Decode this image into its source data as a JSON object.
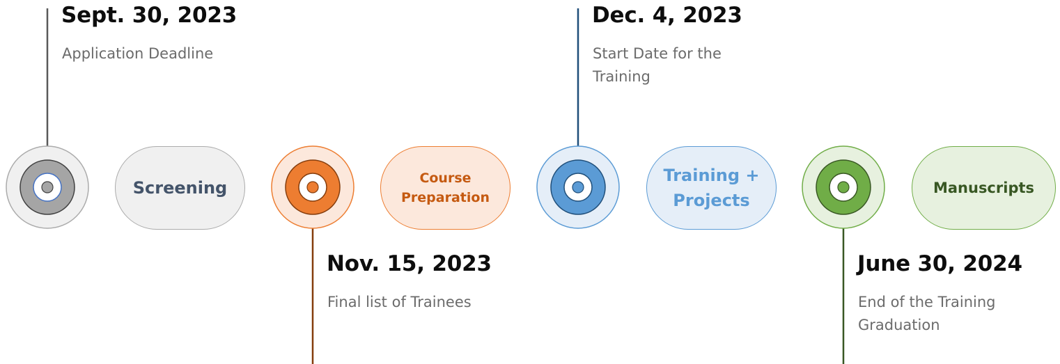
{
  "milestones": [
    {
      "date": "Sept. 30, 2023",
      "description": [
        "Application Deadline"
      ]
    },
    {
      "date": "Nov. 15, 2023",
      "description": [
        "Final list of Trainees"
      ]
    },
    {
      "date": "Dec. 4, 2023",
      "description": [
        "Start Date for the",
        "Training"
      ]
    },
    {
      "date": "June 30, 2024",
      "description": [
        "End of the Training",
        "Graduation"
      ]
    }
  ],
  "phases": [
    {
      "label": [
        "Screening"
      ]
    },
    {
      "label": [
        "Course",
        "Preparation"
      ]
    },
    {
      "label": [
        "Training +",
        "Projects"
      ]
    },
    {
      "label": [
        "Manuscripts"
      ]
    }
  ],
  "colors": {
    "gray": "#a5a5a5",
    "orange": "#ed7d31",
    "blue": "#5b9bd5",
    "green": "#70ad47"
  }
}
